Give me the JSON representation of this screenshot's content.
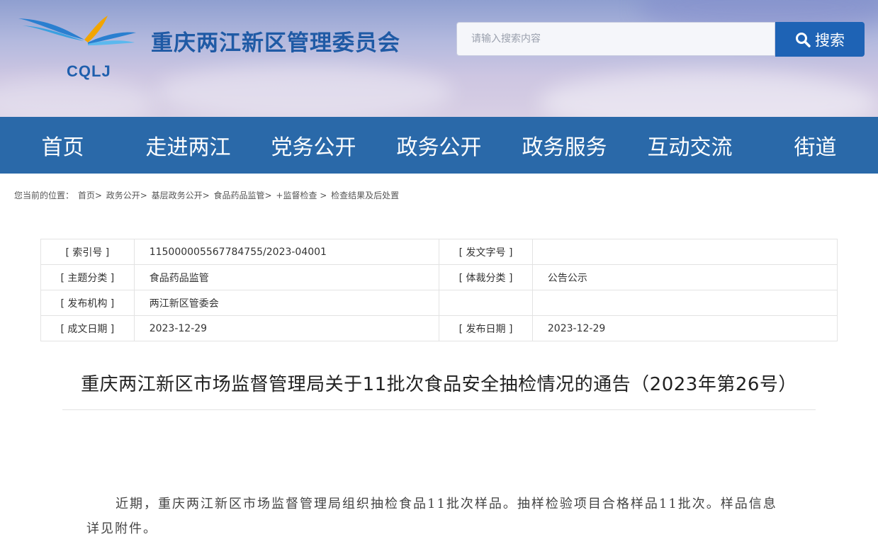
{
  "header": {
    "logo_text": "CQLJ",
    "site_title": "重庆两江新区管理委员会",
    "search": {
      "placeholder": "请输入搜索内容",
      "value": "",
      "button_label": "搜索"
    }
  },
  "nav": {
    "items": [
      "首页",
      "走进两江",
      "党务公开",
      "政务公开",
      "政务服务",
      "互动交流",
      "街道"
    ]
  },
  "breadcrumb": {
    "prefix": "您当前的位置：",
    "items": [
      "首页>",
      "政务公开>",
      "基层政务公开>",
      "食品药品监管>",
      "+监督检查 >",
      "检查结果及后处置"
    ]
  },
  "info": {
    "rows": [
      {
        "k1": "[ 索引号 ]",
        "v1": "115000005567784755/2023-04001",
        "k2": "[ 发文字号 ]",
        "v2": ""
      },
      {
        "k1": "[ 主题分类 ]",
        "v1": "食品药品监管",
        "k2": "[ 体裁分类 ]",
        "v2": "公告公示"
      },
      {
        "k1": "[ 发布机构 ]",
        "v1": "两江新区管委会",
        "k2": "",
        "v2": ""
      },
      {
        "k1": "[ 成文日期 ]",
        "v1": "2023-12-29",
        "k2": "[ 发布日期 ]",
        "v2": "2023-12-29"
      }
    ]
  },
  "article": {
    "title": "重庆两江新区市场监督管理局关于11批次食品安全抽检情况的通告（2023年第26号）",
    "paragraph": "近期，重庆两江新区市场监督管理局组织抽检食品11批次样品。抽样检验项目合格样品11批次。样品信息详见附件。"
  },
  "colors": {
    "nav_bg": "#2a69a9",
    "search_button": "#1e63b5",
    "title_blue": "#1f5aa5"
  }
}
